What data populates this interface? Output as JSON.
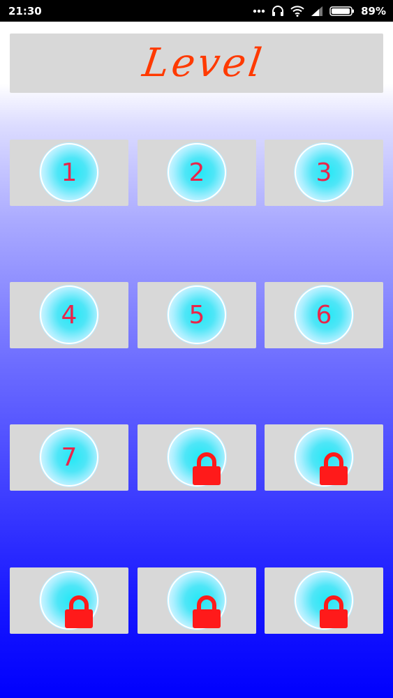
{
  "status_bar": {
    "time": "21:30",
    "battery": "89%",
    "icons": [
      "more-dots-icon",
      "headphones-icon",
      "wifi-icon",
      "signal-icon",
      "battery-icon"
    ]
  },
  "title": "Level",
  "levels": [
    {
      "label": "1",
      "locked": false
    },
    {
      "label": "2",
      "locked": false
    },
    {
      "label": "3",
      "locked": false
    },
    {
      "label": "4",
      "locked": false
    },
    {
      "label": "5",
      "locked": false
    },
    {
      "label": "6",
      "locked": false
    },
    {
      "label": "7",
      "locked": false
    },
    {
      "label": "",
      "locked": true
    },
    {
      "label": "",
      "locked": true
    },
    {
      "label": "",
      "locked": true
    },
    {
      "label": "",
      "locked": true
    },
    {
      "label": "",
      "locked": true
    }
  ],
  "colors": {
    "title_text": "#ff3a00",
    "tile_background": "#d8d8d8",
    "number_color": "#e8264b",
    "lock_color": "#ff1a1a",
    "orb_core": "#23e8f5",
    "gradient_bottom": "#0000fd"
  }
}
